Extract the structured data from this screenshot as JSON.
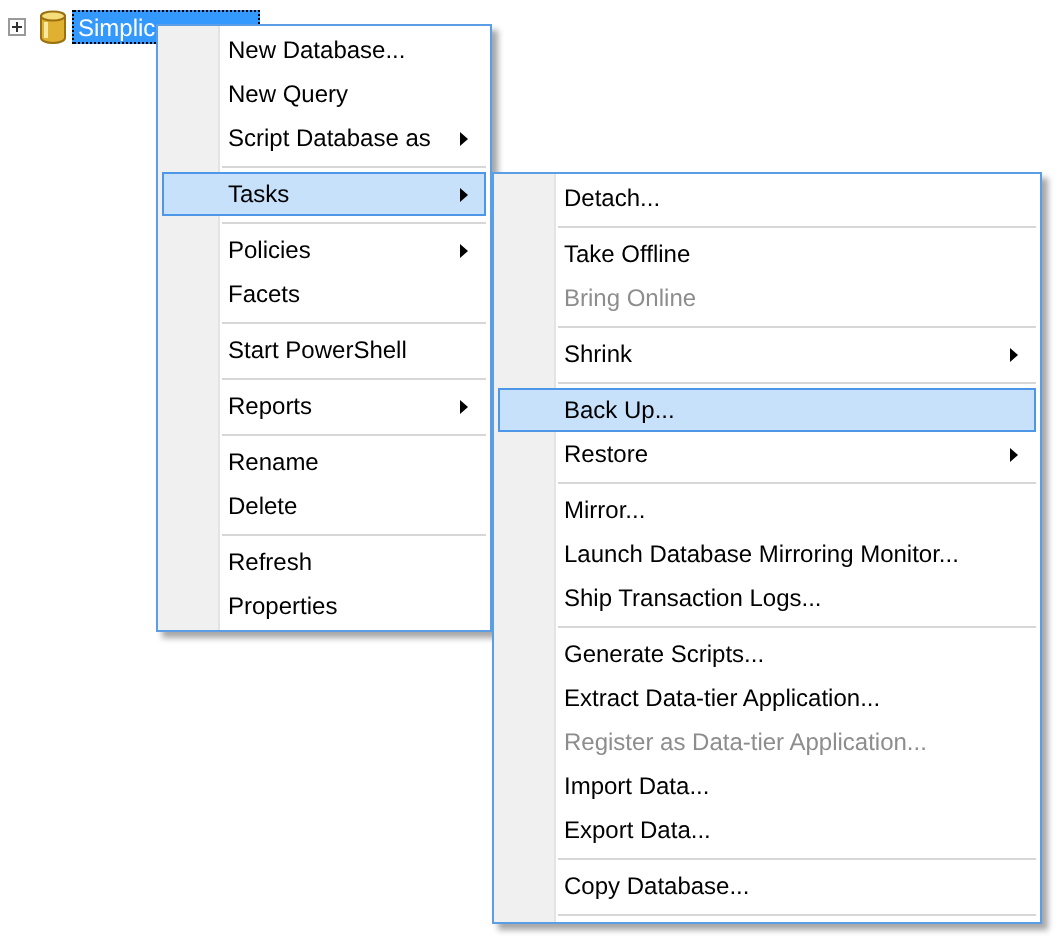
{
  "tree_node": {
    "label": "Simplic",
    "expanded": false,
    "selected": true
  },
  "context_menu": {
    "items": [
      {
        "kind": "item",
        "label": "New Database...",
        "submenu": false,
        "selected": false,
        "disabled": false
      },
      {
        "kind": "item",
        "label": "New Query",
        "submenu": false,
        "selected": false,
        "disabled": false
      },
      {
        "kind": "item",
        "label": "Script Database as",
        "submenu": true,
        "selected": false,
        "disabled": false
      },
      {
        "kind": "separator"
      },
      {
        "kind": "item",
        "label": "Tasks",
        "submenu": true,
        "selected": true,
        "disabled": false
      },
      {
        "kind": "separator"
      },
      {
        "kind": "item",
        "label": "Policies",
        "submenu": true,
        "selected": false,
        "disabled": false
      },
      {
        "kind": "item",
        "label": "Facets",
        "submenu": false,
        "selected": false,
        "disabled": false
      },
      {
        "kind": "separator"
      },
      {
        "kind": "item",
        "label": "Start PowerShell",
        "submenu": false,
        "selected": false,
        "disabled": false
      },
      {
        "kind": "separator"
      },
      {
        "kind": "item",
        "label": "Reports",
        "submenu": true,
        "selected": false,
        "disabled": false
      },
      {
        "kind": "separator"
      },
      {
        "kind": "item",
        "label": "Rename",
        "submenu": false,
        "selected": false,
        "disabled": false
      },
      {
        "kind": "item",
        "label": "Delete",
        "submenu": false,
        "selected": false,
        "disabled": false
      },
      {
        "kind": "separator"
      },
      {
        "kind": "item",
        "label": "Refresh",
        "submenu": false,
        "selected": false,
        "disabled": false
      },
      {
        "kind": "item",
        "label": "Properties",
        "submenu": false,
        "selected": false,
        "disabled": false
      }
    ]
  },
  "tasks_submenu": {
    "items": [
      {
        "kind": "item",
        "label": "Detach...",
        "submenu": false,
        "selected": false,
        "disabled": false
      },
      {
        "kind": "separator"
      },
      {
        "kind": "item",
        "label": "Take Offline",
        "submenu": false,
        "selected": false,
        "disabled": false
      },
      {
        "kind": "item",
        "label": "Bring Online",
        "submenu": false,
        "selected": false,
        "disabled": true
      },
      {
        "kind": "separator"
      },
      {
        "kind": "item",
        "label": "Shrink",
        "submenu": true,
        "selected": false,
        "disabled": false
      },
      {
        "kind": "separator"
      },
      {
        "kind": "item",
        "label": "Back Up...",
        "submenu": false,
        "selected": true,
        "disabled": false
      },
      {
        "kind": "item",
        "label": "Restore",
        "submenu": true,
        "selected": false,
        "disabled": false
      },
      {
        "kind": "separator"
      },
      {
        "kind": "item",
        "label": "Mirror...",
        "submenu": false,
        "selected": false,
        "disabled": false
      },
      {
        "kind": "item",
        "label": "Launch Database Mirroring Monitor...",
        "submenu": false,
        "selected": false,
        "disabled": false
      },
      {
        "kind": "item",
        "label": "Ship Transaction Logs...",
        "submenu": false,
        "selected": false,
        "disabled": false
      },
      {
        "kind": "separator"
      },
      {
        "kind": "item",
        "label": "Generate Scripts...",
        "submenu": false,
        "selected": false,
        "disabled": false
      },
      {
        "kind": "item",
        "label": "Extract Data-tier Application...",
        "submenu": false,
        "selected": false,
        "disabled": false
      },
      {
        "kind": "item",
        "label": "Register as Data-tier Application...",
        "submenu": false,
        "selected": false,
        "disabled": true
      },
      {
        "kind": "item",
        "label": "Import Data...",
        "submenu": false,
        "selected": false,
        "disabled": false
      },
      {
        "kind": "item",
        "label": "Export Data...",
        "submenu": false,
        "selected": false,
        "disabled": false
      },
      {
        "kind": "separator"
      },
      {
        "kind": "item",
        "label": "Copy Database...",
        "submenu": false,
        "selected": false,
        "disabled": false
      },
      {
        "kind": "separator"
      }
    ]
  }
}
